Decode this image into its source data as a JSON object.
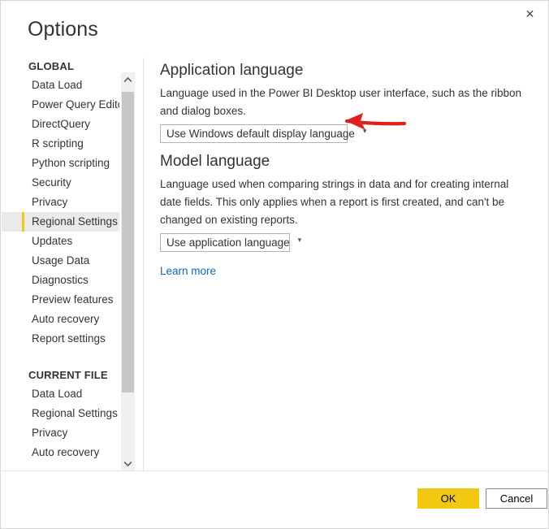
{
  "window": {
    "title": "Options",
    "close_icon": "close-icon"
  },
  "sidebar": {
    "groups": [
      {
        "label": "GLOBAL",
        "items": [
          {
            "label": "Data Load",
            "selected": false
          },
          {
            "label": "Power Query Editor",
            "selected": false
          },
          {
            "label": "DirectQuery",
            "selected": false
          },
          {
            "label": "R scripting",
            "selected": false
          },
          {
            "label": "Python scripting",
            "selected": false
          },
          {
            "label": "Security",
            "selected": false
          },
          {
            "label": "Privacy",
            "selected": false
          },
          {
            "label": "Regional Settings",
            "selected": true
          },
          {
            "label": "Updates",
            "selected": false
          },
          {
            "label": "Usage Data",
            "selected": false
          },
          {
            "label": "Diagnostics",
            "selected": false
          },
          {
            "label": "Preview features",
            "selected": false
          },
          {
            "label": "Auto recovery",
            "selected": false
          },
          {
            "label": "Report settings",
            "selected": false
          }
        ]
      },
      {
        "label": "CURRENT FILE",
        "items": [
          {
            "label": "Data Load",
            "selected": false
          },
          {
            "label": "Regional Settings",
            "selected": false
          },
          {
            "label": "Privacy",
            "selected": false
          },
          {
            "label": "Auto recovery",
            "selected": false
          }
        ]
      }
    ],
    "scrollbar": {
      "up_arrow_icon": "chevron-up-icon",
      "down_arrow_icon": "chevron-down-icon"
    }
  },
  "content": {
    "application_language": {
      "heading": "Application language",
      "description": "Language used in the Power BI Desktop user interface, such as the ribbon and dialog boxes.",
      "dropdown_value": "Use Windows default display language",
      "caret_icon": "chevron-down-icon"
    },
    "model_language": {
      "heading": "Model language",
      "description": "Language used when comparing strings in data and for creating internal date fields. This only applies when a report is first created, and can't be changed on existing reports.",
      "dropdown_value": "Use application language",
      "caret_icon": "chevron-down-icon"
    },
    "learn_more_link": "Learn more"
  },
  "footer": {
    "ok_label": "OK",
    "cancel_label": "Cancel"
  },
  "annotation": {
    "type": "arrow",
    "color": "#e02020",
    "points_to": "application-language-dropdown"
  },
  "colors": {
    "accent": "#f2c811",
    "link": "#1268c3",
    "selected_bg": "#eaeaea",
    "annotation_red": "#e02020"
  }
}
